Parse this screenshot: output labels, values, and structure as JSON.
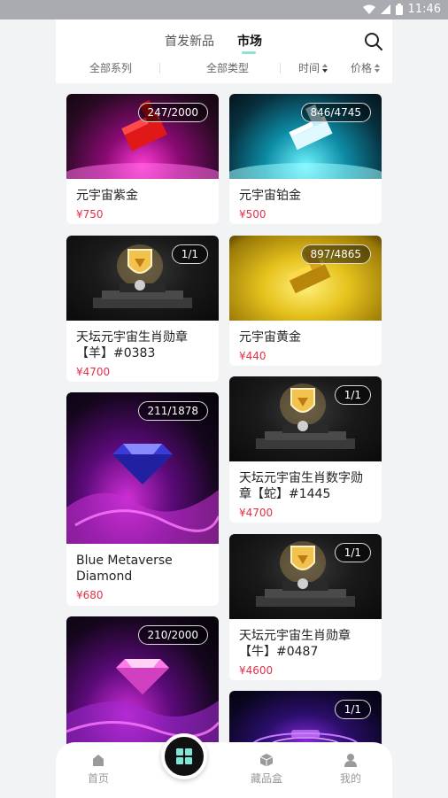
{
  "status_bar": {
    "time": "11:46"
  },
  "header": {
    "tabs": [
      {
        "label": "首发新品",
        "active": false
      },
      {
        "label": "市场",
        "active": true
      }
    ],
    "filters": [
      {
        "label": "全部系列"
      },
      {
        "label": "全部类型"
      },
      {
        "label": "时间"
      },
      {
        "label": "价格"
      }
    ]
  },
  "cards": [
    {
      "title": "元宇宙紫金",
      "price": "¥750",
      "badge": "247/2000"
    },
    {
      "title": "元宇宙铂金",
      "price": "¥500",
      "badge": "846/4745"
    },
    {
      "title": "天坛元宇宙生肖勋章【羊】#0383",
      "price": "¥4700",
      "badge": "1/1"
    },
    {
      "title": "元宇宙黄金",
      "price": "¥440",
      "badge": "897/4865"
    },
    {
      "title": "Blue Metaverse Diamond",
      "price": "¥680",
      "badge": "211/1878"
    },
    {
      "title": "天坛元宇宙生肖数字勋章【蛇】#1445",
      "price": "¥4700",
      "badge": "1/1"
    },
    {
      "title": "",
      "price": "",
      "badge": "210/2000"
    },
    {
      "title": "天坛元宇宙生肖勋章【牛】#0487",
      "price": "¥4600",
      "badge": "1/1"
    },
    {
      "title": "",
      "price": "",
      "badge": "1/1"
    }
  ],
  "bottom_nav": [
    {
      "label": "首页",
      "icon": "home-icon"
    },
    {
      "label": "",
      "icon": "grid-icon"
    },
    {
      "label": "藏品盒",
      "icon": "box-icon"
    },
    {
      "label": "我的",
      "icon": "user-icon"
    }
  ],
  "colors": {
    "price": "#e0304a",
    "accent": "#8fe0d7",
    "background": "#f2f3f5"
  }
}
